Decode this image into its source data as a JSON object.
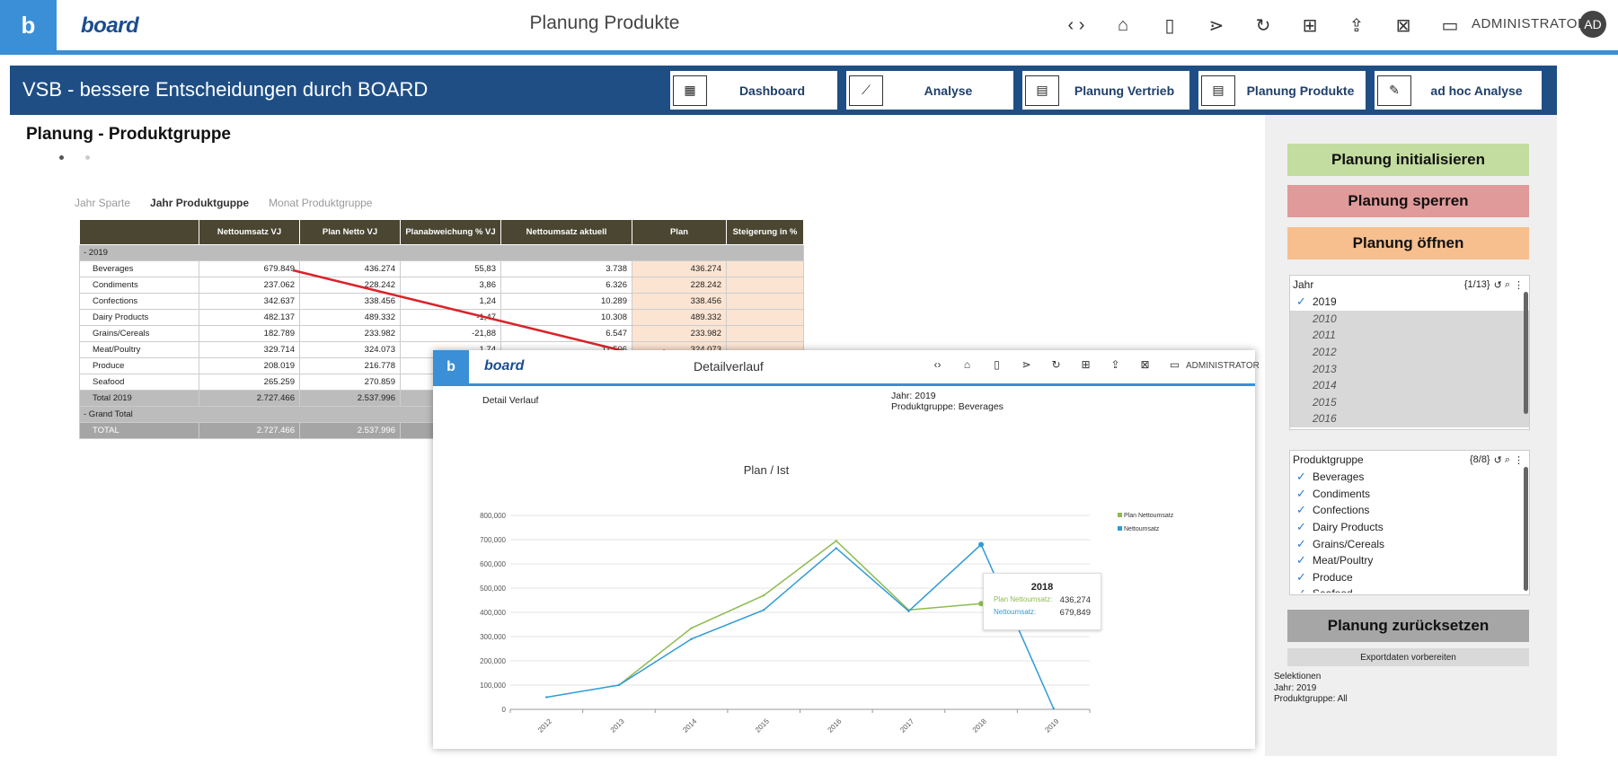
{
  "topbar": {
    "logo_letter": "b",
    "brand": "board",
    "title": "Planung Produkte",
    "user": "ADMINISTRATOR",
    "avatar": "AD",
    "icons": [
      "code-nav-icon",
      "home-icon",
      "panel-icon",
      "tree-icon",
      "refresh-icon",
      "presentation-icon",
      "share-icon",
      "excel-icon",
      "comments-icon"
    ]
  },
  "band": {
    "title": "VSB - bessere Entscheidungen durch BOARD",
    "nav": [
      {
        "label": "Dashboard",
        "icon": "dashboard-icon"
      },
      {
        "label": "Analyse",
        "icon": "line-chart-icon"
      },
      {
        "label": "Planung Vertrieb",
        "icon": "planning-icon"
      },
      {
        "label": "Planung Produkte",
        "icon": "planning-icon"
      },
      {
        "label": "ad hoc Analyse",
        "icon": "pen-icon"
      }
    ]
  },
  "main": {
    "section_title": "Planung  -  Produktgruppe",
    "tabs": [
      "Jahr Sparte",
      "Jahr Produktguppe",
      "Monat Produktgruppe"
    ],
    "table": {
      "headers": [
        "",
        "Nettoumsatz VJ",
        "Plan Netto VJ",
        "Planabweichung % VJ",
        "Nettoumsatz aktuell",
        "Plan",
        "Steigerung in %"
      ],
      "group_label": "-  2019",
      "rows": [
        [
          "Beverages",
          "679.849",
          "436.274",
          "55,83",
          "3.738",
          "436.274",
          ""
        ],
        [
          "Condiments",
          "237.062",
          "228.242",
          "3,86",
          "6.326",
          "228.242",
          ""
        ],
        [
          "Confections",
          "342.637",
          "338.456",
          "1,24",
          "10.289",
          "338.456",
          ""
        ],
        [
          "Dairy Products",
          "482.137",
          "489.332",
          "-1,47",
          "10.308",
          "489.332",
          ""
        ],
        [
          "Grains/Cereals",
          "182.789",
          "233.982",
          "-21,88",
          "6.547",
          "233.982",
          ""
        ],
        [
          "Meat/Poultry",
          "329.714",
          "324.073",
          "1,74",
          "11.506",
          "324.073",
          ""
        ],
        [
          "Produce",
          "208.019",
          "216.778",
          "",
          "",
          "",
          ""
        ],
        [
          "Seafood",
          "265.259",
          "270.859",
          "",
          "",
          "",
          ""
        ]
      ],
      "total_row": [
        "Total 2019",
        "2.727.466",
        "2.537.996",
        "",
        "",
        "",
        ""
      ],
      "grand_total_label": "-  Grand Total",
      "grand_row": [
        "TOTAL",
        "2.727.466",
        "2.537.996",
        "",
        "",
        "",
        ""
      ]
    }
  },
  "right_panel": {
    "buttons": [
      {
        "label": "Planung initialisieren",
        "color": "#c3dc9f"
      },
      {
        "label": "Planung sperren",
        "color": "#e09a9a"
      },
      {
        "label": "Planung öffnen",
        "color": "#f7bf8e"
      }
    ],
    "jahr": {
      "title": "Jahr",
      "count": "{1/13}",
      "items": [
        {
          "label": "2019",
          "checked": true
        },
        {
          "label": "2010",
          "checked": false
        },
        {
          "label": "2011",
          "checked": false
        },
        {
          "label": "2012",
          "checked": false
        },
        {
          "label": "2013",
          "checked": false
        },
        {
          "label": "2014",
          "checked": false
        },
        {
          "label": "2015",
          "checked": false
        },
        {
          "label": "2016",
          "checked": false
        }
      ]
    },
    "produktgruppe": {
      "title": "Produktgruppe",
      "count": "{8/8}",
      "items": [
        {
          "label": "Beverages",
          "checked": true
        },
        {
          "label": "Condiments",
          "checked": true
        },
        {
          "label": "Confections",
          "checked": true
        },
        {
          "label": "Dairy Products",
          "checked": true
        },
        {
          "label": "Grains/Cereals",
          "checked": true
        },
        {
          "label": "Meat/Poultry",
          "checked": true
        },
        {
          "label": "Produce",
          "checked": true
        },
        {
          "label": "Seafood",
          "checked": true
        }
      ]
    },
    "reset_button": {
      "label": "Planung zurücksetzen",
      "color": "#a6a6a6"
    },
    "export_label": "Exportdaten vorbereiten",
    "selections": [
      "Selektionen",
      "Jahr: 2019",
      "Produktgruppe: All"
    ]
  },
  "popup": {
    "logo_letter": "b",
    "brand": "board",
    "title": "Detailverlauf",
    "user": "ADMINISTRATOR",
    "subtitle": "Detail Verlauf",
    "meta_year": "Jahr: 2019",
    "meta_group": "Produktgruppe: Beverages",
    "tooltip": {
      "year": "2018",
      "plan_label": "Plan Nettoumsatz:",
      "plan_value": "436,274",
      "net_label": "Nettoumsatz:",
      "net_value": "679,849"
    }
  },
  "chart_data": {
    "type": "line",
    "title": "Plan / Ist",
    "categories": [
      "2012",
      "2013",
      "2014",
      "2015",
      "2016",
      "2017",
      "2018",
      "2019"
    ],
    "series": [
      {
        "name": "Plan Nettoumsatz",
        "color": "#8dbb4f",
        "values": [
          null,
          100000,
          335000,
          470000,
          695000,
          410000,
          436274,
          null
        ]
      },
      {
        "name": "Nettoumsatz",
        "color": "#2f9bd6",
        "values": [
          50000,
          100000,
          290000,
          410000,
          665000,
          405000,
          679849,
          3738
        ]
      }
    ],
    "yticks": [
      "0",
      "100,000",
      "200,000",
      "300,000",
      "400,000",
      "500,000",
      "600,000",
      "700,000",
      "800,000"
    ],
    "ylim": [
      0,
      800000
    ],
    "grid": true,
    "legend_position": "top-right"
  }
}
